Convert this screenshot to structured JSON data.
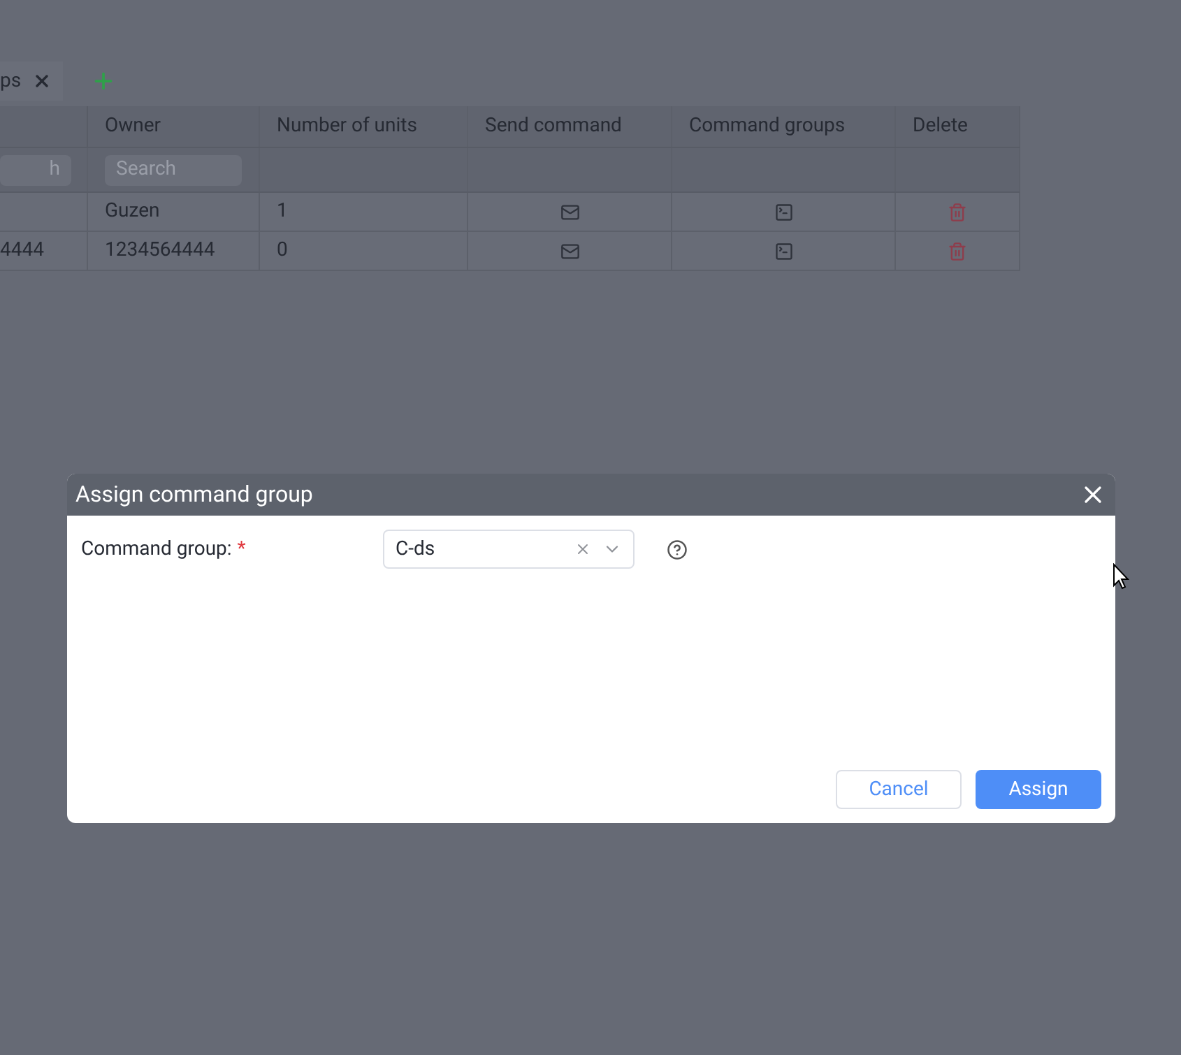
{
  "tabs": [
    {
      "label": "ps"
    }
  ],
  "table": {
    "columns": [
      "Owner",
      "Number of units",
      "Send command",
      "Command groups",
      "Delete"
    ],
    "filters": [
      {
        "placeholder": "h"
      },
      {
        "placeholder": "Search"
      }
    ],
    "rows": [
      {
        "owner": "Guzen",
        "units": "1"
      },
      {
        "column_1": "4444",
        "owner": "1234564444",
        "units": "0"
      }
    ]
  },
  "dialog": {
    "title": "Assign command group",
    "field": {
      "label": "Command group:",
      "required_marker": "*",
      "value": "C-ds"
    },
    "buttons": [
      {
        "label": "Cancel",
        "kind": "secondary"
      },
      {
        "label": "Assign",
        "kind": "primary"
      }
    ]
  }
}
